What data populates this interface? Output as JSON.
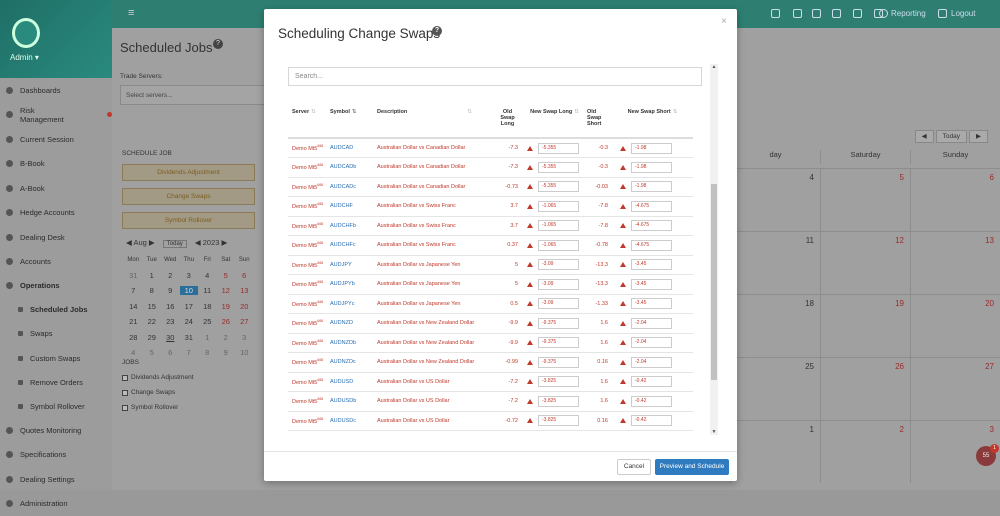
{
  "topbar": {
    "reporting": "Reporting",
    "logout": "Logout"
  },
  "sidebar": {
    "admin": "Admin",
    "items": [
      {
        "label": "Dashboards"
      },
      {
        "label": "Risk Management"
      },
      {
        "label": "Current Session"
      },
      {
        "label": "B-Book"
      },
      {
        "label": "A-Book"
      },
      {
        "label": "Hedge Accounts"
      },
      {
        "label": "Dealing Desk"
      },
      {
        "label": "Accounts"
      },
      {
        "label": "Operations"
      },
      {
        "label": "Scheduled Jobs"
      },
      {
        "label": "Swaps"
      },
      {
        "label": "Custom Swaps"
      },
      {
        "label": "Remove Orders"
      },
      {
        "label": "Symbol Rollover"
      },
      {
        "label": "Quotes Monitoring"
      },
      {
        "label": "Specifications"
      },
      {
        "label": "Dealing Settings"
      },
      {
        "label": "Administration"
      }
    ]
  },
  "page": {
    "title": "Scheduled Jobs",
    "trade_servers_label": "Trade Servers:",
    "select_placeholder": "Select servers...",
    "schedule_job_label": "SCHEDULE JOB",
    "job_buttons": [
      "Dividends Adjustment",
      "Change Swaps",
      "Symbol Rollover"
    ],
    "jobs_label": "JOBS",
    "job_checkboxes": [
      "Dividends Adjustment",
      "Change Swaps",
      "Symbol Rollover"
    ]
  },
  "mini_calendar": {
    "month": "Aug",
    "year": "2023",
    "today": "Today",
    "days_header": [
      "Mon",
      "Tue",
      "Wed",
      "Thu",
      "Fri",
      "Sat",
      "Sun"
    ],
    "weeks": [
      [
        "31",
        "1",
        "2",
        "3",
        "4",
        "5",
        "6"
      ],
      [
        "7",
        "8",
        "9",
        "10",
        "11",
        "12",
        "13"
      ],
      [
        "14",
        "15",
        "16",
        "17",
        "18",
        "19",
        "20"
      ],
      [
        "21",
        "22",
        "23",
        "24",
        "25",
        "26",
        "27"
      ],
      [
        "28",
        "29",
        "30",
        "31",
        "1",
        "2",
        "3"
      ],
      [
        "4",
        "5",
        "6",
        "7",
        "8",
        "9",
        "10"
      ]
    ]
  },
  "calendar": {
    "today": "Today",
    "days": [
      "day",
      "Saturday",
      "Sunday"
    ],
    "weeks": [
      [
        "4",
        "5",
        "6"
      ],
      [
        "11",
        "12",
        "13"
      ],
      [
        "18",
        "19",
        "20"
      ],
      [
        "25",
        "26",
        "27"
      ],
      [
        "1",
        "2",
        "3"
      ]
    ]
  },
  "notifications": {
    "count": "55",
    "badge": "1"
  },
  "modal": {
    "title": "Scheduling Change Swaps",
    "search_placeholder": "Search...",
    "columns": [
      "Server",
      "Symbol",
      "Description",
      "Old Swap Long",
      "New Swap Long",
      "Old Swap Short",
      "New Swap Short"
    ],
    "rows": [
      {
        "server": "Demo Mt5",
        "sup": "666",
        "symbol": "AUDCAD",
        "desc": "Australian Dollar vs Canadian Dollar",
        "old_long": "-7.3",
        "new_long": "-5.355",
        "old_short": "-0.3",
        "new_short": "-1.98"
      },
      {
        "server": "Demo Mt5",
        "sup": "666",
        "symbol": "AUDCADb",
        "desc": "Australian Dollar vs Canadian Dollar",
        "old_long": "-7.3",
        "new_long": "-5.355",
        "old_short": "-0.3",
        "new_short": "-1.98"
      },
      {
        "server": "Demo Mt5",
        "sup": "666",
        "symbol": "AUDCADc",
        "desc": "Australian Dollar vs Canadian Dollar",
        "old_long": "-0.73",
        "new_long": "-5.355",
        "old_short": "-0.03",
        "new_short": "-1.98"
      },
      {
        "server": "Demo Mt5",
        "sup": "666",
        "symbol": "AUDCHF",
        "desc": "Australian Dollar vs Swiss Franc",
        "old_long": "3.7",
        "new_long": "-1.065",
        "old_short": "-7.8",
        "new_short": "-4.675"
      },
      {
        "server": "Demo Mt5",
        "sup": "666",
        "symbol": "AUDCHFb",
        "desc": "Australian Dollar vs Swiss Franc",
        "old_long": "3.7",
        "new_long": "-1.065",
        "old_short": "-7.8",
        "new_short": "-4.675"
      },
      {
        "server": "Demo Mt5",
        "sup": "666",
        "symbol": "AUDCHFc",
        "desc": "Australian Dollar vs Swiss Franc",
        "old_long": "0.37",
        "new_long": "-1.065",
        "old_short": "-0.78",
        "new_short": "-4.675"
      },
      {
        "server": "Demo Mt5",
        "sup": "666",
        "symbol": "AUDJPY",
        "desc": "Australian Dollar vs Japanese Yen",
        "old_long": "5",
        "new_long": "-3.09",
        "old_short": "-13.3",
        "new_short": "-3.45"
      },
      {
        "server": "Demo Mt5",
        "sup": "666",
        "symbol": "AUDJPYb",
        "desc": "Australian Dollar vs Japanese Yen",
        "old_long": "5",
        "new_long": "-3.09",
        "old_short": "-13.3",
        "new_short": "-3.45"
      },
      {
        "server": "Demo Mt5",
        "sup": "666",
        "symbol": "AUDJPYc",
        "desc": "Australian Dollar vs Japanese Yen",
        "old_long": "0.5",
        "new_long": "-3.09",
        "old_short": "-1.33",
        "new_short": "-3.45"
      },
      {
        "server": "Demo Mt5",
        "sup": "666",
        "symbol": "AUDNZD",
        "desc": "Australian Dollar vs New Zealand Dollar",
        "old_long": "-9.9",
        "new_long": "-9.375",
        "old_short": "1.6",
        "new_short": "-2.04"
      },
      {
        "server": "Demo Mt5",
        "sup": "666",
        "symbol": "AUDNZDb",
        "desc": "Australian Dollar vs New Zealand Dollar",
        "old_long": "-9.9",
        "new_long": "-9.375",
        "old_short": "1.6",
        "new_short": "-2.04"
      },
      {
        "server": "Demo Mt5",
        "sup": "666",
        "symbol": "AUDNZDc",
        "desc": "Australian Dollar vs New Zealand Dollar",
        "old_long": "-0.99",
        "new_long": "-9.375",
        "old_short": "0.16",
        "new_short": "-2.04"
      },
      {
        "server": "Demo Mt5",
        "sup": "666",
        "symbol": "AUDUSD",
        "desc": "Australian Dollar vs US Dollar",
        "old_long": "-7.2",
        "new_long": "-3.825",
        "old_short": "1.6",
        "new_short": "-0.42"
      },
      {
        "server": "Demo Mt5",
        "sup": "666",
        "symbol": "AUDUSDb",
        "desc": "Australian Dollar vs US Dollar",
        "old_long": "-7.2",
        "new_long": "-3.825",
        "old_short": "1.6",
        "new_short": "-0.42"
      },
      {
        "server": "Demo Mt5",
        "sup": "666",
        "symbol": "AUDUSDc",
        "desc": "Australian Dollar vs US Dollar",
        "old_long": "-0.72",
        "new_long": "-3.825",
        "old_short": "0.16",
        "new_short": "-0.42"
      }
    ],
    "cancel": "Cancel",
    "preview": "Preview and Schedule"
  }
}
